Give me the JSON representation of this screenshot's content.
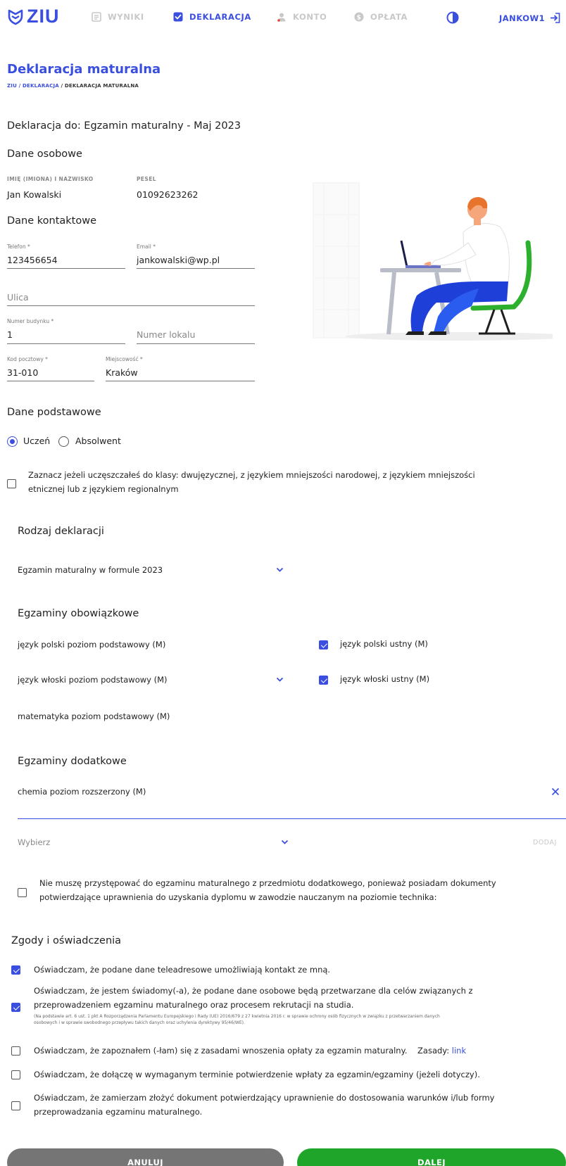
{
  "nav": {
    "logo": "ZIU",
    "items": [
      {
        "label": "WYNIKI"
      },
      {
        "label": "DEKLARACJA"
      },
      {
        "label": "KONTO"
      },
      {
        "label": "OPŁATA"
      }
    ],
    "user": "JANKOW1",
    "icons": [
      "results-icon",
      "declaration-check-icon",
      "account-icon",
      "payment-icon",
      "theme-contrast-icon",
      "logout-icon"
    ]
  },
  "page": {
    "title": "Deklaracja maturalna",
    "breadcrumb": {
      "link1": "ZIU",
      "sep1": " / ",
      "link2": "DEKLARACJA",
      "sep2": " / ",
      "current": "DEKLARACJA MATURALNA"
    }
  },
  "declaration_for": "Deklaracja do: Egzamin maturalny - Maj 2023",
  "personal": {
    "heading": "Dane osobowe",
    "name_label": "IMIĘ (IMIONA) I NAZWISKO",
    "name_value": "Jan Kowalski",
    "pesel_label": "PESEL",
    "pesel_value": "01092623262"
  },
  "contact": {
    "heading": "Dane kontaktowe",
    "phone_label": "Telefon *",
    "phone_value": "123456654",
    "email_label": "Email *",
    "email_value": "jankowalski@wp.pl",
    "street_placeholder": "Ulica",
    "building_label": "Numer budynku *",
    "building_value": "1",
    "apartment_placeholder": "Numer lokalu",
    "postal_label": "Kod pocztowy *",
    "postal_value": "31-010",
    "city_label": "Miejscowość *",
    "city_value": "Kraków"
  },
  "basic": {
    "heading": "Dane podstawowe",
    "radio_student": "Uczeń",
    "radio_graduate": "Absolwent",
    "selected": "Uczeń",
    "bilingual_line1": "Zaznacz jeżeli uczęszczałeś do klasy: dwujęzycznej, z językiem mniejszości narodowej, z językiem mniejszości",
    "bilingual_line2": "etnicznej lub z językiem regionalnym"
  },
  "declaration_type": {
    "heading": "Rodzaj deklaracji",
    "value": "Egzamin maturalny w formule 2023"
  },
  "mandatory": {
    "heading": "Egzaminy obowiązkowe",
    "exam1": "język polski poziom podstawowy (M)",
    "exam2": "język włoski poziom podstawowy (M)",
    "exam3": "matematyka poziom podstawowy (M)",
    "oral1": "język polski ustny (M)",
    "oral2": "język włoski ustny (M)"
  },
  "additional": {
    "heading": "Egzaminy dodatkowe",
    "selected_exam": "chemia poziom rozszerzony (M)",
    "select_placeholder": "Wybierz",
    "add_label": "DODAJ",
    "exempt_line1": "Nie muszę przystępować do egzaminu maturalnego z przedmiotu dodatkowego, ponieważ posiadam dokumenty",
    "exempt_line2": "potwierdzające uprawnienia do uzyskania dyplomu w zawodzie nauczanym na poziomie technika:"
  },
  "consents": {
    "heading": "Zgody i oświadczenia",
    "c1": "Oświadczam, że podane dane teleadresowe umożliwiają kontakt ze mną.",
    "c2_line1": "Oświadczam, że jestem świadomy(-a), że podane dane osobowe będą przetwarzane dla celów związanych z",
    "c2_line2": "przeprowadzeniem egzaminu maturalnego oraz procesem rekrutacji na studia.",
    "c2_note1": "(Na podstawie art. 6 ust. 1 pkt A Rozporządzenia Parlamentu Europejskiego i Rady (UE) 2016/679 z 27 kwietnia 2016 r. w sprawie ochrony osób fizycznych w związku z przetwarzaniem danych",
    "c2_note2": "osobowych i w sprawie swobodnego przepływu takich danych oraz uchylenia dyrektywy 95/46/WE).",
    "c3": "Oświadczam, że zapoznałem (-łam) się z zasadami wnoszenia opłaty za egzamin maturalny.",
    "c3_rules": "Zasady:",
    "c3_link": "link",
    "c4": "Oświadczam, że dołączę w wymaganym terminie potwierdzenie wpłaty za egzamin/egzaminy (jeżeli dotyczy).",
    "c5_line1": "Oświadczam, że zamierzam złożyć dokument potwierdzający uprawnienie do dostosowania warunków i/lub formy",
    "c5_line2": "przeprowadzania egzaminu maturalnego."
  },
  "buttons": {
    "cancel": "ANULUJ",
    "next": "DALEJ"
  },
  "colors": {
    "accent": "#3a4ee0",
    "next_button": "#1fa52a",
    "cancel_button": "#757575"
  }
}
